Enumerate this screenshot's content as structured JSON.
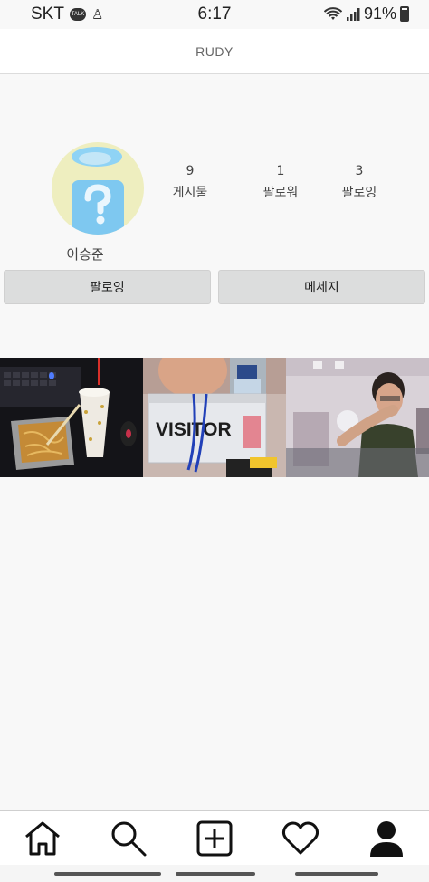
{
  "status_bar": {
    "carrier": "SKT",
    "talk_badge": "TALK",
    "time": "6:17",
    "battery": "91%"
  },
  "header": {
    "title": "RUDY"
  },
  "profile": {
    "name": "이승준",
    "stats": {
      "posts": {
        "count": "9",
        "label": "게시물"
      },
      "followers": {
        "count": "1",
        "label": "팔로워"
      },
      "following": {
        "count": "3",
        "label": "팔로잉"
      }
    },
    "follow_button": "팔로잉",
    "message_button": "메세지"
  },
  "photos": {
    "visitor_card_text": "VISITOR"
  },
  "bottom_nav": {
    "items": [
      "home-icon",
      "search-icon",
      "add-post-icon",
      "heart-icon",
      "profile-icon"
    ]
  },
  "colors": {
    "avatar_bg": "#eeeebf",
    "avatar_figure": "#7ec8f0",
    "button_bg": "#dcdddd",
    "page_bg": "#f8f8f8"
  }
}
